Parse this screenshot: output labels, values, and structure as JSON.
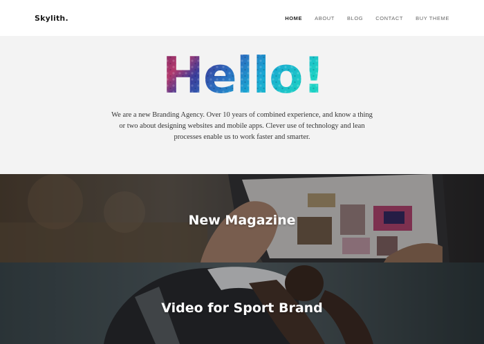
{
  "brand": {
    "logo": "Skylith."
  },
  "nav": {
    "items": [
      {
        "label": "HOME"
      },
      {
        "label": "ABOUT"
      },
      {
        "label": "BLOG"
      },
      {
        "label": "CONTACT"
      },
      {
        "label": "BUY THEME"
      }
    ]
  },
  "hero": {
    "headline": "Hello!",
    "text": "We are a new Branding Agency. Over 10 years of combined experience, and know a thing or two about designing websites and mobile apps. Clever use of technology and lean processes enable us to work faster and smarter."
  },
  "projects": [
    {
      "title": "New Magazine"
    },
    {
      "title": "Video for Sport Brand"
    }
  ],
  "colors": {
    "hero_bg": "#f3f3f3",
    "accent_teal": "#18c6c6",
    "accent_magenta": "#8e2a6e",
    "accent_blue": "#2a58b8"
  }
}
